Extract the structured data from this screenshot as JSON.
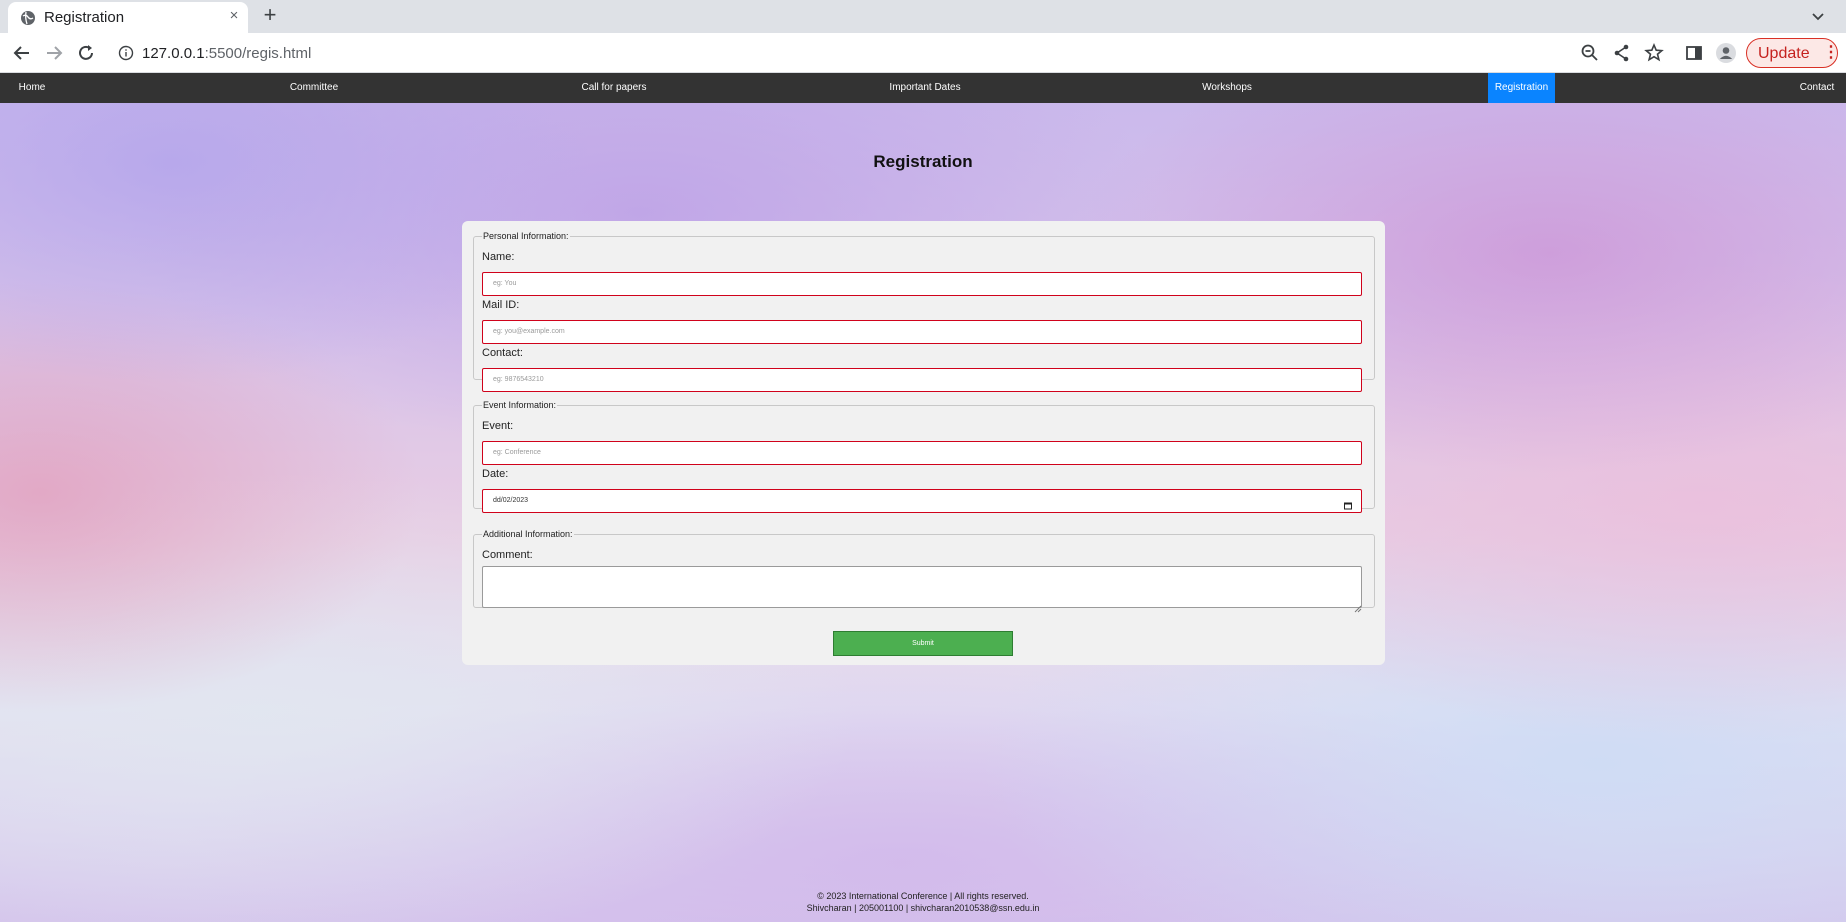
{
  "browser": {
    "tab_title": "Registration",
    "tab_close": "×",
    "new_tab": "+",
    "url_host": "127.0.0.1",
    "url_rest": ":5500/regis.html",
    "update_label": "Update",
    "menu_glyph": "⋮",
    "icons": [
      "globe-icon",
      "close-icon",
      "plus-icon",
      "chevron-down-icon",
      "back-arrow-icon",
      "forward-arrow-icon",
      "reload-icon",
      "info-icon",
      "zoom-icon",
      "share-icon",
      "star-icon",
      "side-panel-icon",
      "profile-icon"
    ],
    "colors": {
      "update_border": "#d93025",
      "update_text": "#c5221f"
    }
  },
  "site_nav": {
    "items": [
      {
        "label": "Home"
      },
      {
        "label": "Committee"
      },
      {
        "label": "Call for papers"
      },
      {
        "label": "Important Dates"
      },
      {
        "label": "Workshops"
      },
      {
        "label": "Registration",
        "active": true
      },
      {
        "label": "Contact"
      }
    ],
    "colors": {
      "background": "#333333",
      "active": "#0a84ff"
    }
  },
  "page": {
    "title": "Registration"
  },
  "form": {
    "personal": {
      "legend": "Personal Information:",
      "name_label": "Name:",
      "name_placeholder": "eg: You",
      "mail_label": "Mail ID:",
      "mail_placeholder": "eg: you@example.com",
      "contact_label": "Contact:",
      "contact_placeholder": "eg: 9876543210"
    },
    "event": {
      "legend": "Event Information:",
      "event_label": "Event:",
      "event_placeholder": "eg: Conference",
      "date_label": "Date:",
      "date_value": "dd/02/2023"
    },
    "additional": {
      "legend": "Additional Information:",
      "comment_label": "Comment:",
      "comment_value": ""
    },
    "submit_label": "Submit",
    "colors": {
      "input_border": "#d0021b",
      "submit": "#4caf50"
    }
  },
  "footer": {
    "line1": "© 2023 International Conference | All rights reserved.",
    "line2": "Shivcharan | 205001100 | shivcharan2010538@ssn.edu.in"
  }
}
